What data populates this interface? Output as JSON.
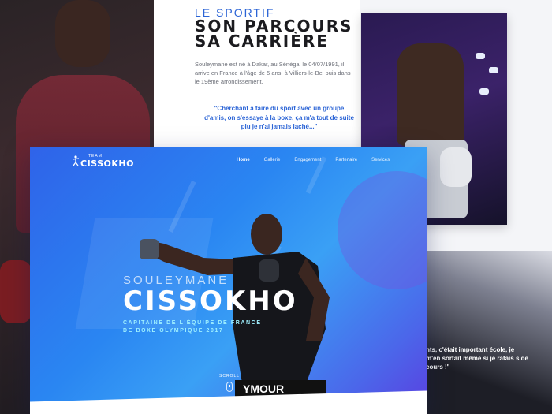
{
  "about": {
    "kicker": "LE SPORTIF",
    "title_line1": "SON PARCOURS",
    "title_line2": "SA CARRIÈRE",
    "bio": "Souleymane est né à Dakar, au Sénégal le 04/07/1991, il arrive en France à l'âge de 5 ans, à Villiers-le-Bel puis dans le 19ème arrondissement.",
    "quote": "\"Cherchant à faire du sport avec un groupe d'amis, on s'essaye à la boxe, ça m'a tout de suite plu je n'ai jamais laché...\""
  },
  "secondary_quote": "nts, c'était important école, je m'en sortait même si je ratais s de cours !\"",
  "hero": {
    "logo_team": "TEAM",
    "logo_name": "CISSOKHO",
    "nav": [
      "Home",
      "Gallerie",
      "Engagement",
      "Partenaire",
      "Services"
    ],
    "first_name": "SOULEYMANE",
    "last_name": "CISSOKHO",
    "subtitle_line1": "CAPITAINE DE L'ÉQUIPE DE FRANCE",
    "subtitle_line2": "DE BOXE OLYMPIQUE 2017",
    "scroll_label": "SCROLL",
    "shorts_text": "YMOUR"
  },
  "colors": {
    "accent_blue": "#2b64d6",
    "subtitle_cyan": "#9ff0ff",
    "hero_gradient_start": "#2f63e9",
    "hero_gradient_end": "#5a3fe0"
  }
}
